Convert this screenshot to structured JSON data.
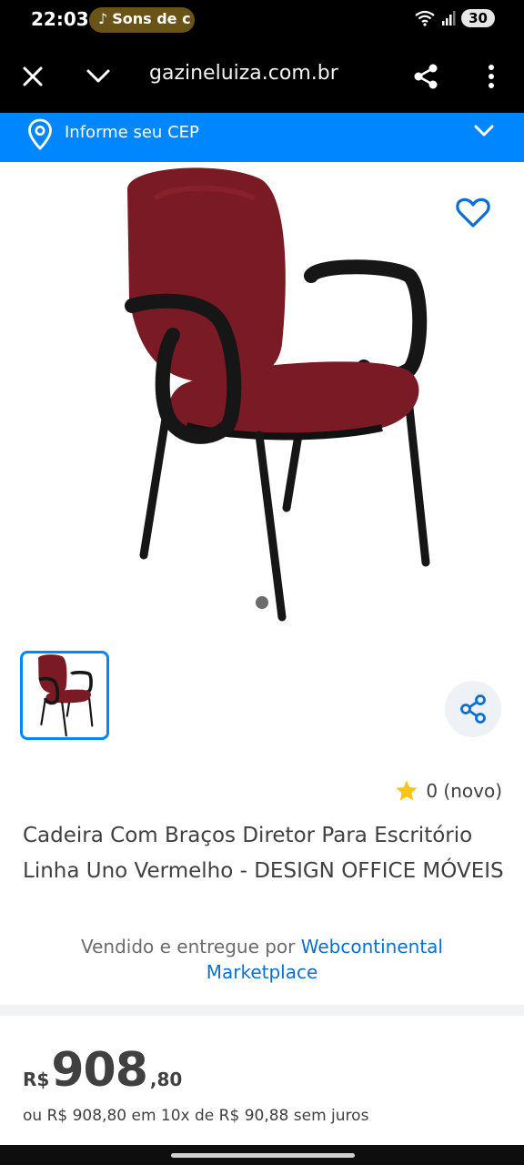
{
  "status_bar": {
    "time": "22:03",
    "music_label": "Sons de c",
    "battery": "30"
  },
  "browser": {
    "url": "gazineluiza.com.br"
  },
  "cep": {
    "label": "Informe seu CEP"
  },
  "product": {
    "rating_value": "0 (novo)",
    "title": "Cadeira Com Braços Diretor Para Escritório Linha Uno Vermelho - DESIGN OFFICE MÓVEIS",
    "seller_prefix": "Vendido e entregue por ",
    "seller_name": "Webcontinental Marketplace",
    "price_currency": "R$",
    "price_integer": "908",
    "price_cents": ",80",
    "installments": "ou R$ 908,80 em 10x de R$ 90,88 sem juros"
  },
  "colors": {
    "brand_blue": "#0086ff",
    "chair_red": "#7a1a24",
    "star": "#f5c518"
  },
  "icons": [
    "close-icon",
    "chevron-down-icon",
    "share-icon",
    "more-vert-icon",
    "location-pin-icon",
    "heart-icon",
    "star-icon",
    "music-note-icon",
    "wifi-icon",
    "signal-icon"
  ]
}
